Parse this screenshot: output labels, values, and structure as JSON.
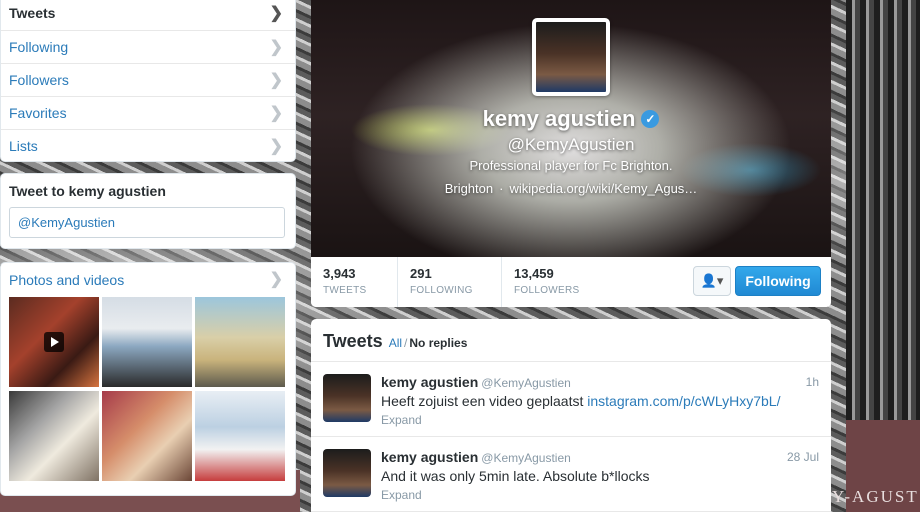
{
  "nav": {
    "items": [
      {
        "label": "Tweets",
        "active": true
      },
      {
        "label": "Following",
        "active": false
      },
      {
        "label": "Followers",
        "active": false
      },
      {
        "label": "Favorites",
        "active": false
      },
      {
        "label": "Lists",
        "active": false
      }
    ]
  },
  "tweet_to": {
    "title": "Tweet to kemy agustien",
    "value": "@KemyAgustien"
  },
  "photos": {
    "title": "Photos and videos"
  },
  "profile": {
    "name": "kemy agustien",
    "handle": "@KemyAgustien",
    "bio": "Professional player for Fc Brighton.",
    "location": "Brighton",
    "separator": "·",
    "url": "wikipedia.org/wiki/Kemy_Agus…",
    "stats": [
      {
        "value": "3,943",
        "label": "TWEETS"
      },
      {
        "value": "291",
        "label": "FOLLOWING"
      },
      {
        "value": "13,459",
        "label": "FOLLOWERS"
      }
    ],
    "follow_button": "Following"
  },
  "stream": {
    "title": "Tweets",
    "filter_all": "All",
    "filter_slash": "/",
    "filter_noreplies": "No replies",
    "tweets": [
      {
        "name": "kemy agustien",
        "handle": "@KemyAgustien",
        "time": "1h",
        "text": "Heeft zojuist een video geplaatst",
        "link": "instagram.com/p/cWLyHxy7bL/",
        "expand": "Expand"
      },
      {
        "name": "kemy agustien",
        "handle": "@KemyAgustien",
        "time": "28 Jul",
        "text": "And it was only 5min late. Absolute b*llocks",
        "link": "",
        "expand": "Expand"
      }
    ]
  },
  "background": {
    "brand_text": "Y-AGUST"
  },
  "colors": {
    "link": "#2b7bb9",
    "follow_button": "#2a92dc",
    "verified": "#3a9ae0"
  },
  "icons": {
    "chevron": "chevron-right-icon",
    "verified": "verified-badge-icon",
    "user_actions": "user-icon",
    "play": "play-icon"
  }
}
